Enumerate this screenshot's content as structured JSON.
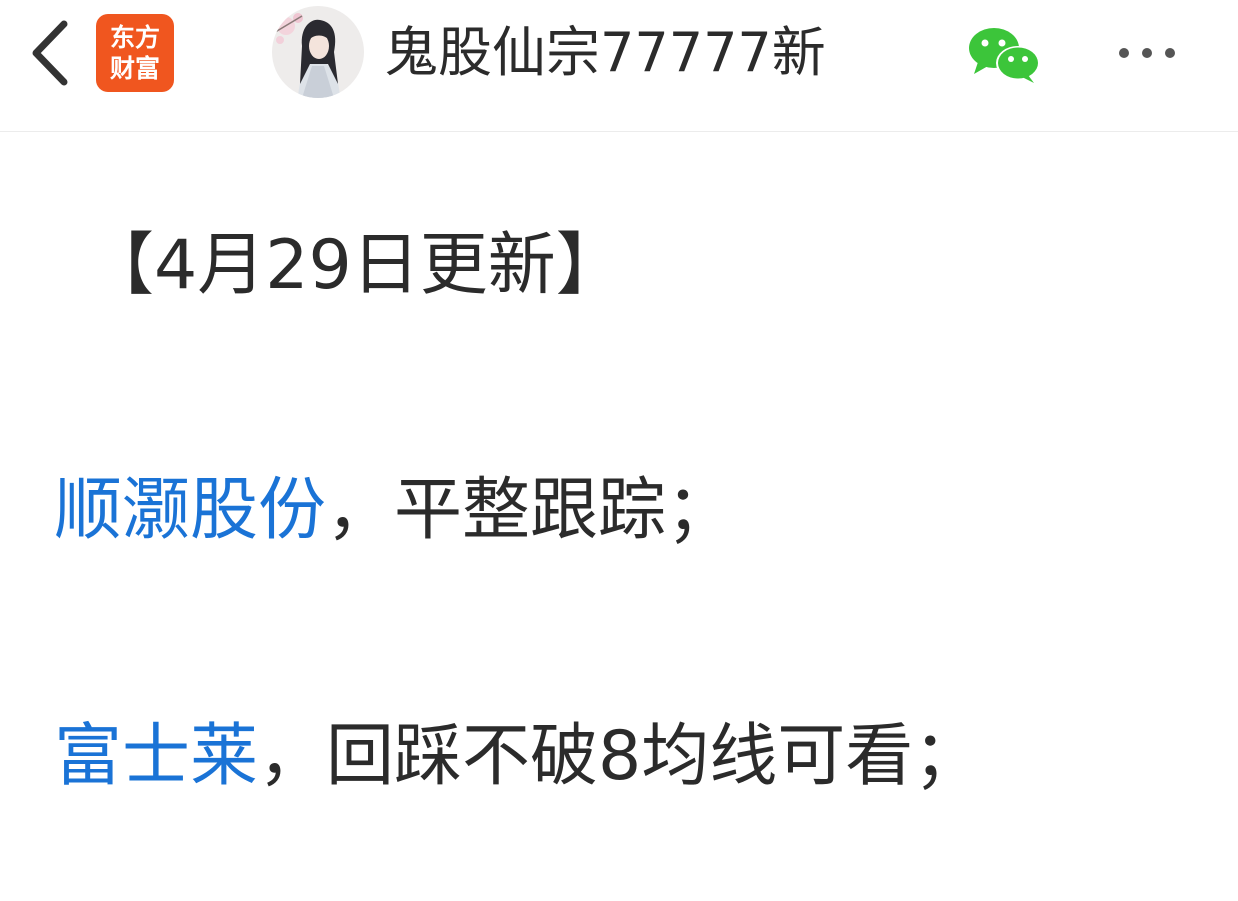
{
  "header": {
    "app_logo": {
      "line1": "东方",
      "line2": "财富",
      "color": "#f0561f"
    },
    "username": "鬼股仙宗77777新",
    "icons": {
      "back": "chevron-left-icon",
      "share": "wechat-icon",
      "more": "more-horizontal-icon"
    }
  },
  "post": {
    "title": "【4月29日更新】",
    "lines": [
      {
        "stock": "顺灏股份",
        "comment": "，平整跟踪；"
      },
      {
        "stock": "富士莱",
        "comment": "，回踩不破8均线可看；"
      }
    ]
  },
  "colors": {
    "link": "#1a73d6",
    "text": "#2b2b2b",
    "wechat": "#3cc53a"
  }
}
